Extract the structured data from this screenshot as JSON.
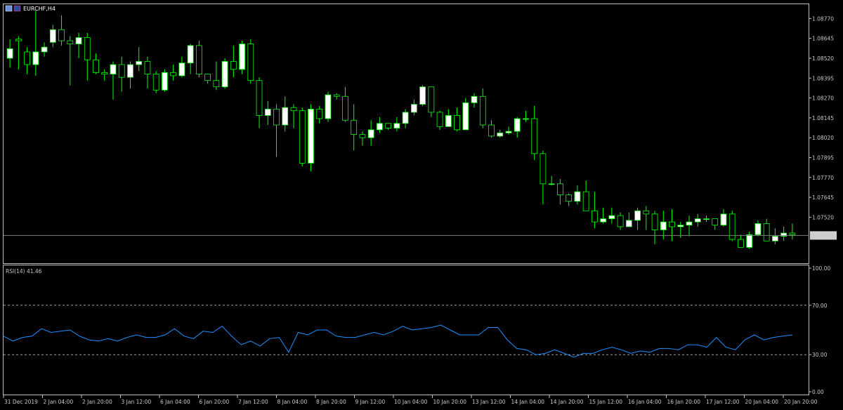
{
  "window": {
    "title": "EURCHF,H4"
  },
  "colors": {
    "background": "#000000",
    "frame": "#c0c0c0",
    "candle_up": "#ffffff",
    "candle_down": "#000000",
    "wick": "#00ff00",
    "rsi_line": "#1e90ff",
    "price_line": "#808080",
    "level_line": "#a0a0a0"
  },
  "chart_data": [
    {
      "type": "candlestick",
      "symbol": "EURCHF",
      "timeframe": "H4",
      "current_price": "1.07405",
      "y_ticks": [
        "1.08770",
        "1.08645",
        "1.08520",
        "1.08395",
        "1.08270",
        "1.08145",
        "1.08020",
        "1.07895",
        "1.07770",
        "1.07645",
        "1.07520",
        "1.07405"
      ],
      "ylim": [
        1.0723,
        1.0886
      ],
      "x_labels": [
        "31 Dec 2019",
        "2 Jan 04:00",
        "2 Jan 20:00",
        "3 Jan 12:00",
        "6 Jan 04:00",
        "6 Jan 20:00",
        "7 Jan 12:00",
        "8 Jan 04:00",
        "8 Jan 20:00",
        "9 Jan 12:00",
        "10 Jan 04:00",
        "10 Jan 20:00",
        "13 Jan 12:00",
        "14 Jan 04:00",
        "14 Jan 20:00",
        "15 Jan 12:00",
        "16 Jan 04:00",
        "16 Jan 20:00",
        "17 Jan 12:00",
        "20 Jan 04:00",
        "20 Jan 20:00"
      ],
      "candles": [
        [
          1.0852,
          1.0858,
          1.0846,
          1.0864
        ],
        [
          1.0864,
          1.0863,
          1.0845,
          1.0866
        ],
        [
          1.0856,
          1.0848,
          1.0842,
          1.0859
        ],
        [
          1.0848,
          1.0856,
          1.0841,
          1.0882
        ],
        [
          1.0856,
          1.0859,
          1.0853,
          1.0862
        ],
        [
          1.0862,
          1.087,
          1.0859,
          1.0873
        ],
        [
          1.087,
          1.0863,
          1.086,
          1.0879
        ],
        [
          1.0863,
          1.0861,
          1.0835,
          1.0866
        ],
        [
          1.0861,
          1.0865,
          1.0852,
          1.0868
        ],
        [
          1.0865,
          1.0851,
          1.0838,
          1.0868
        ],
        [
          1.0851,
          1.0843,
          1.0842,
          1.0855
        ],
        [
          1.0843,
          1.0842,
          1.0838,
          1.0845
        ],
        [
          1.0842,
          1.0848,
          1.0826,
          1.085
        ],
        [
          1.0848,
          1.084,
          1.0831,
          1.0853
        ],
        [
          1.084,
          1.0848,
          1.0833,
          1.085
        ],
        [
          1.0848,
          1.085,
          1.0844,
          1.0859
        ],
        [
          1.085,
          1.0842,
          1.0833,
          1.0853
        ],
        [
          1.0842,
          1.0832,
          1.083,
          1.0844
        ],
        [
          1.0832,
          1.0843,
          1.0831,
          1.0845
        ],
        [
          1.0843,
          1.0841,
          1.0838,
          1.0848
        ],
        [
          1.0841,
          1.0849,
          1.084,
          1.0853
        ],
        [
          1.0849,
          1.086,
          1.0842,
          1.0861
        ],
        [
          1.086,
          1.0842,
          1.084,
          1.0863
        ],
        [
          1.0842,
          1.0838,
          1.0836,
          1.0842
        ],
        [
          1.0838,
          1.0834,
          1.0832,
          1.085
        ],
        [
          1.0834,
          1.085,
          1.0833,
          1.0852
        ],
        [
          1.085,
          1.0845,
          1.084,
          1.086
        ],
        [
          1.0845,
          1.0861,
          1.0842,
          1.0863
        ],
        [
          1.0861,
          1.0838,
          1.0836,
          1.0864
        ],
        [
          1.0838,
          1.0816,
          1.0808,
          1.084
        ],
        [
          1.0816,
          1.082,
          1.081,
          1.0825
        ],
        [
          1.082,
          1.081,
          1.079,
          1.0823
        ],
        [
          1.081,
          1.0821,
          1.0806,
          1.0828
        ],
        [
          1.0821,
          1.0819,
          1.0808,
          1.0823
        ],
        [
          1.0819,
          1.0786,
          1.0784,
          1.0821
        ],
        [
          1.0786,
          1.082,
          1.0781,
          1.0823
        ],
        [
          1.082,
          1.0814,
          1.0811,
          1.0822
        ],
        [
          1.0814,
          1.0829,
          1.0812,
          1.0831
        ],
        [
          1.0829,
          1.0828,
          1.0826,
          1.083
        ],
        [
          1.0828,
          1.0813,
          1.0812,
          1.0834
        ],
        [
          1.0813,
          1.0804,
          1.0794,
          1.0823
        ],
        [
          1.0804,
          1.0802,
          1.0797,
          1.0806
        ],
        [
          1.0802,
          1.0807,
          1.0797,
          1.0813
        ],
        [
          1.0807,
          1.0811,
          1.0805,
          1.0815
        ],
        [
          1.0811,
          1.0808,
          1.0807,
          1.0811
        ],
        [
          1.0808,
          1.0811,
          1.0806,
          1.0815
        ],
        [
          1.0811,
          1.0818,
          1.0808,
          1.082
        ],
        [
          1.0818,
          1.0823,
          1.0816,
          1.0826
        ],
        [
          1.0823,
          1.0834,
          1.0822,
          1.0835
        ],
        [
          1.0834,
          1.0818,
          1.0815,
          1.0829
        ],
        [
          1.0818,
          1.0809,
          1.0807,
          1.0819
        ],
        [
          1.0809,
          1.0816,
          1.0811,
          1.082
        ],
        [
          1.0816,
          1.0807,
          1.0806,
          1.0821
        ],
        [
          1.0807,
          1.0824,
          1.0815,
          1.0827
        ],
        [
          1.0824,
          1.0828,
          1.0821,
          1.083
        ],
        [
          1.0828,
          1.081,
          1.0808,
          1.0833
        ],
        [
          1.081,
          1.0803,
          1.0802,
          1.0813
        ],
        [
          1.0803,
          1.0805,
          1.0802,
          1.0807
        ],
        [
          1.0805,
          1.0806,
          1.0804,
          1.0809
        ],
        [
          1.0806,
          1.0814,
          1.0802,
          1.0815
        ],
        [
          1.0814,
          1.0814,
          1.0812,
          1.0819
        ],
        [
          1.0814,
          1.0792,
          1.0788,
          1.0822
        ],
        [
          1.0792,
          1.0773,
          1.076,
          1.0794
        ],
        [
          1.0773,
          1.0773,
          1.0772,
          1.0778
        ],
        [
          1.0773,
          1.0766,
          1.076,
          1.0776
        ],
        [
          1.0766,
          1.0762,
          1.0759,
          1.0767
        ],
        [
          1.0762,
          1.0768,
          1.076,
          1.0772
        ],
        [
          1.0768,
          1.0756,
          1.0756,
          1.0775
        ],
        [
          1.0756,
          1.0749,
          1.0745,
          1.0768
        ],
        [
          1.0749,
          1.0751,
          1.0748,
          1.0758
        ],
        [
          1.0751,
          1.0753,
          1.0748,
          1.0758
        ],
        [
          1.0753,
          1.0746,
          1.0744,
          1.0755
        ],
        [
          1.0746,
          1.075,
          1.0746,
          1.0755
        ],
        [
          1.075,
          1.0756,
          1.0744,
          1.0758
        ],
        [
          1.0756,
          1.0754,
          1.0744,
          1.0759
        ],
        [
          1.0754,
          1.0744,
          1.0735,
          1.0756
        ],
        [
          1.0744,
          1.0749,
          1.0738,
          1.0756
        ],
        [
          1.0749,
          1.0746,
          1.0737,
          1.0757
        ],
        [
          1.0746,
          1.0747,
          1.0739,
          1.0749
        ],
        [
          1.0747,
          1.0749,
          1.074,
          1.0753
        ],
        [
          1.0749,
          1.0751,
          1.0746,
          1.0754
        ],
        [
          1.0751,
          1.0751,
          1.0749,
          1.0753
        ],
        [
          1.0751,
          1.0747,
          1.0744,
          1.0751
        ],
        [
          1.0747,
          1.0754,
          1.0746,
          1.0757
        ],
        [
          1.0754,
          1.0738,
          1.0737,
          1.0756
        ],
        [
          1.0738,
          1.0733,
          1.0733,
          1.0741
        ],
        [
          1.0733,
          1.0741,
          1.0732,
          1.0743
        ],
        [
          1.0741,
          1.0748,
          1.074,
          1.075
        ],
        [
          1.0748,
          1.0737,
          1.0737,
          1.0751
        ],
        [
          1.0737,
          1.074,
          1.0735,
          1.0745
        ],
        [
          1.074,
          1.0742,
          1.0737,
          1.0746
        ],
        [
          1.0742,
          1.0741,
          1.0738,
          1.0748
        ]
      ]
    },
    {
      "type": "line",
      "title": "RSI(14) 41.46",
      "ylim": [
        0,
        100
      ],
      "y_ticks": [
        "100.00",
        "70.00",
        "30.00",
        "0.00"
      ],
      "levels": [
        70,
        30
      ],
      "series": [
        {
          "name": "RSI(14)",
          "values": [
            45,
            41,
            44,
            45,
            51,
            48,
            49,
            50,
            45,
            42,
            41,
            43,
            41,
            44,
            46,
            44,
            44,
            46,
            51,
            45,
            43,
            49,
            48,
            53,
            45,
            38,
            41,
            37,
            43,
            44,
            32,
            48,
            46,
            50,
            50,
            45,
            44,
            44,
            46,
            48,
            46,
            49,
            53,
            50,
            51,
            52,
            54,
            50,
            46,
            46,
            46,
            52,
            52,
            42,
            35,
            34,
            30,
            31,
            34,
            31,
            28,
            31,
            31,
            34,
            36,
            34,
            31,
            33,
            32,
            35,
            35,
            34,
            38,
            38,
            36,
            44,
            36,
            34,
            42,
            46,
            42,
            44,
            45,
            46
          ]
        }
      ]
    }
  ]
}
